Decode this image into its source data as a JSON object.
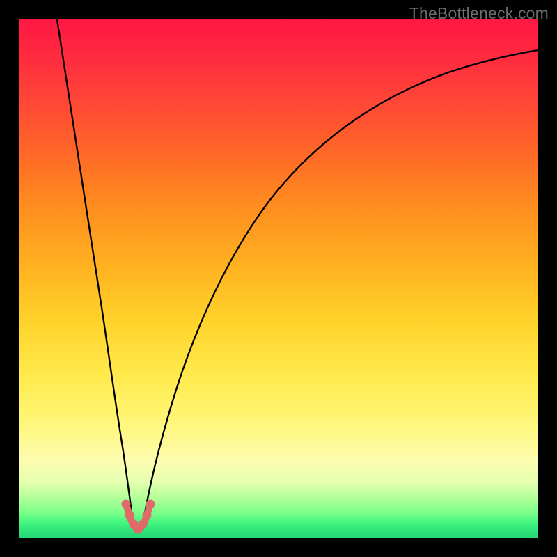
{
  "watermark": "TheBottleneck.com",
  "colors": {
    "black_frame": "#000000",
    "curve": "#000000",
    "trough_accent": "#e06a6a",
    "gradient_top": "#ff1744",
    "gradient_mid": "#ffe84a",
    "gradient_bottom": "#26d675"
  },
  "chart_data": {
    "type": "line",
    "title": "",
    "xlabel": "",
    "ylabel": "",
    "xlim": [
      0,
      100
    ],
    "ylim": [
      0,
      100
    ],
    "grid": false,
    "legend": false,
    "series": [
      {
        "name": "curve",
        "x_min_at": 21,
        "x": [
          0,
          5,
          10,
          12,
          14,
          16,
          17,
          18,
          19,
          20,
          21,
          22,
          23,
          24,
          25,
          27,
          30,
          35,
          40,
          45,
          50,
          55,
          60,
          65,
          70,
          75,
          80,
          85,
          90,
          95,
          100
        ],
        "y": [
          100,
          80,
          55,
          44,
          33,
          22,
          16,
          11,
          6,
          3,
          2,
          3,
          5,
          8,
          11,
          17,
          25,
          37,
          47,
          55,
          62,
          67,
          72,
          76,
          79,
          82,
          84,
          86,
          88,
          89,
          90
        ]
      }
    ],
    "trough_highlight": {
      "x": [
        18.8,
        19.5,
        20.2,
        21,
        21.8,
        22.5,
        23.2
      ],
      "y": [
        7.2,
        4.5,
        2.8,
        2.2,
        2.8,
        4.5,
        7.2
      ]
    }
  }
}
